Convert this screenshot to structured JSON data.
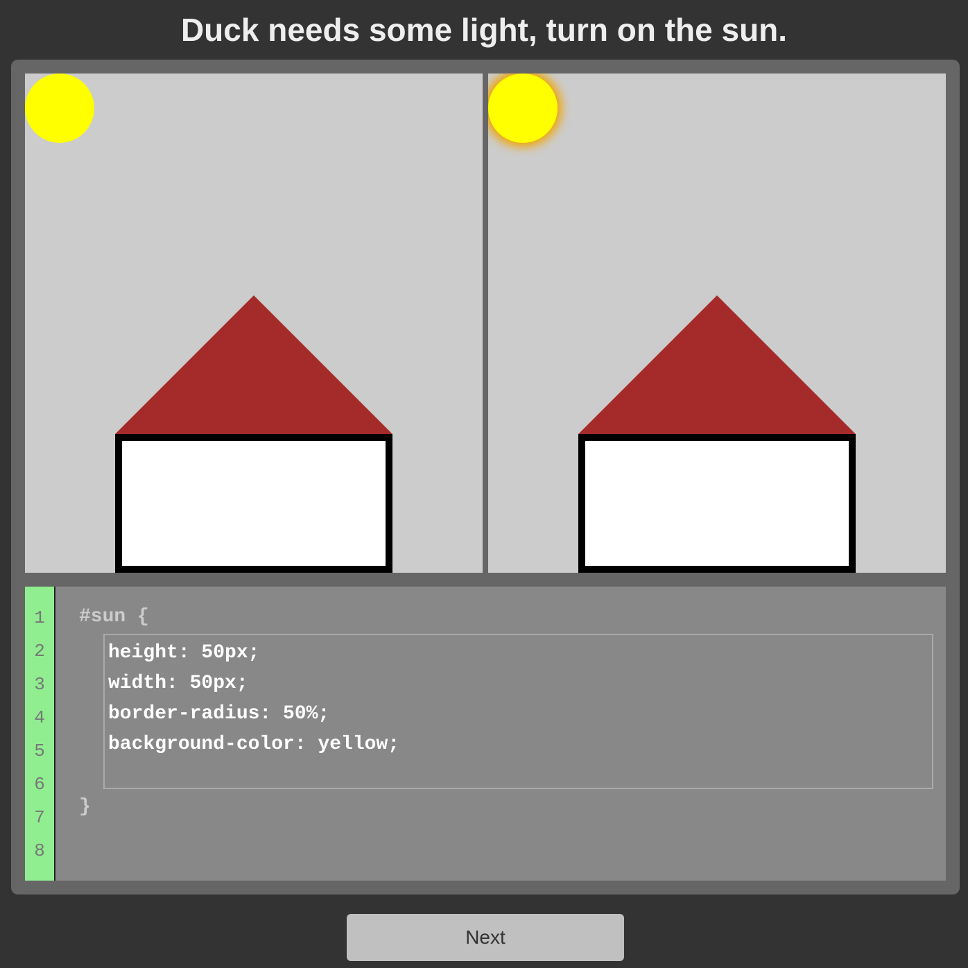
{
  "title": "Duck needs some light, turn on the sun.",
  "colors": {
    "sun": "#ffff00",
    "sun_glow": "#f0a500",
    "roof": "#a52a2a",
    "house_body": "#ffffff",
    "sky": "#cccccc",
    "gutter": "#90ee90"
  },
  "editor": {
    "line_numbers": [
      "1",
      "2",
      "3",
      "4",
      "5",
      "6",
      "7",
      "8"
    ],
    "selector_line": "#sun {",
    "input_lines": [
      "height: 50px;",
      "width: 50px;",
      "border-radius: 50%;",
      "background-color: yellow;"
    ],
    "closing_line": "}"
  },
  "next_button": {
    "label": "Next"
  }
}
